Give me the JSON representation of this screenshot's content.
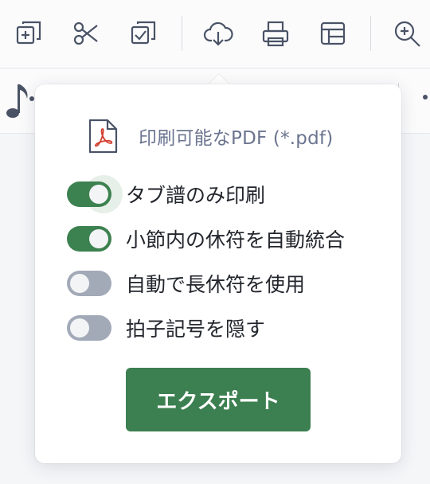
{
  "toolbar": {
    "icons": [
      "copy-add-icon",
      "scissors-icon",
      "paste-check-icon",
      "cloud-download-icon",
      "printer-icon",
      "layout-icon",
      "zoom-in-icon"
    ]
  },
  "export_popup": {
    "format_label": "印刷可能なPDF (*.pdf)",
    "options": [
      {
        "label": "タブ譜のみ印刷",
        "on": true
      },
      {
        "label": "小節内の休符を自動統合",
        "on": true
      },
      {
        "label": "自動で長休符を使用",
        "on": false
      },
      {
        "label": "拍子記号を隠す",
        "on": false
      }
    ],
    "export_button": "エクスポート"
  },
  "colors": {
    "accent_green": "#3c7f50",
    "toggle_off": "#a2a9b7",
    "icon_gray": "#4a5366",
    "pdf_red": "#d4402f"
  }
}
